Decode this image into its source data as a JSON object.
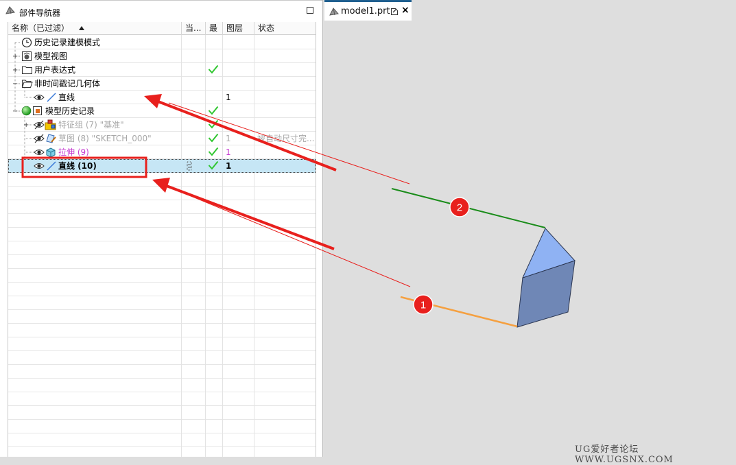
{
  "navigator": {
    "title": "部件导航器",
    "columns": {
      "name": "名称（已过滤）",
      "current": "当...",
      "latest": "最",
      "layer": "图层",
      "status": "状态"
    },
    "rows": [
      {
        "label": "历史记录建模模式",
        "icon": "clock-icon",
        "style": "normal"
      },
      {
        "label": "模型视图",
        "icon": "model-view-icon",
        "style": "normal",
        "expander": "+"
      },
      {
        "label": "用户表达式",
        "icon": "folder-icon",
        "style": "normal",
        "expander": "+",
        "latest": "check"
      },
      {
        "label": "非时间戳记几何体",
        "icon": "folder-open-icon",
        "style": "normal",
        "expander": "−"
      },
      {
        "label": "直线",
        "icon": "line-icon",
        "style": "normal",
        "layer": "1"
      },
      {
        "label": "模型历史记录",
        "icon": "model-history-icon",
        "style": "normal",
        "expander": "−",
        "latest": "check"
      },
      {
        "label": "特征组 (7) \"基准\"",
        "icon": "feature-group-icon",
        "style": "dim",
        "expander": "+",
        "latest": "check"
      },
      {
        "label": "草图 (8) \"SKETCH_000\"",
        "icon": "sketch-icon",
        "style": "dim",
        "latest": "check",
        "layer": "1",
        "status": "被自动尺寸完..."
      },
      {
        "label": "拉伸 (9)",
        "icon": "extrude-icon",
        "style": "pink",
        "latest": "check",
        "layer": "1"
      },
      {
        "label": "直线 (10)",
        "icon": "line-icon",
        "style": "bold",
        "latest": "check",
        "layer": "1",
        "selected": true
      }
    ]
  },
  "graphics_tab": {
    "title": "model1.prt",
    "close": "×"
  },
  "annotations": {
    "badge_1": "1",
    "badge_2": "2"
  },
  "watermark": "UG爱好者论坛 WWW.UGSNX.COM",
  "colors": {
    "selection": "#c6e6f5",
    "annotation_red": "#e8201d",
    "line_green": "#1a8c1a",
    "line_orange": "#f5a040",
    "prism_front": "#6f87b6",
    "prism_top": "#8fb2f3",
    "check_green": "#2fc62f"
  }
}
